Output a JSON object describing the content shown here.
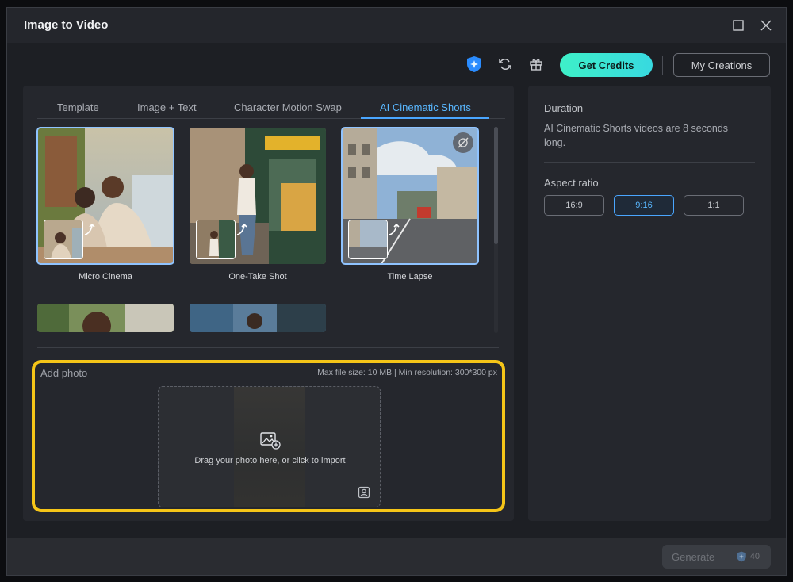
{
  "window": {
    "title": "Image to Video"
  },
  "toolbar": {
    "get_credits": "Get Credits",
    "my_creations": "My Creations"
  },
  "tabs": [
    {
      "label": "Template"
    },
    {
      "label": "Image + Text"
    },
    {
      "label": "Character Motion Swap"
    },
    {
      "label": "AI Cinematic Shorts",
      "active": true
    }
  ],
  "templates": [
    {
      "label": "Micro Cinema",
      "selected": true
    },
    {
      "label": "One-Take Shot"
    },
    {
      "label": "Time Lapse",
      "selected": true
    },
    {
      "label": ""
    },
    {
      "label": ""
    }
  ],
  "upload": {
    "title": "Add photo",
    "limits": "Max file size: 10 MB | Min resolution: 300*300 px",
    "drop_text": "Drag your photo here, or click to import"
  },
  "settings": {
    "duration_label": "Duration",
    "duration_desc": "AI Cinematic Shorts videos are 8 seconds long.",
    "aspect_label": "Aspect ratio",
    "ratios": [
      "16:9",
      "9:16",
      "1:1"
    ],
    "selected_ratio": "9:16"
  },
  "footer": {
    "generate": "Generate",
    "cost": "40"
  },
  "colors": {
    "accent": "#4aa6ff",
    "highlight": "#f5c518",
    "credits_start": "#3ef0c8",
    "credits_end": "#38d9e0"
  }
}
